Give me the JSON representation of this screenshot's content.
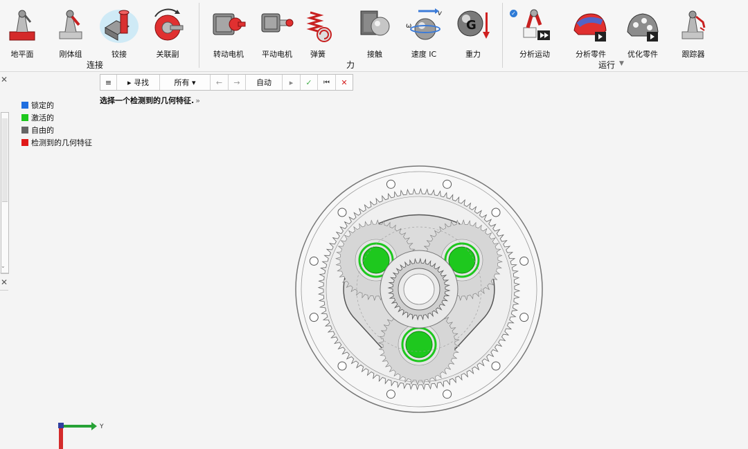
{
  "ribbon": {
    "tools": [
      {
        "label": "地平面",
        "icon": "ground-plane-icon"
      },
      {
        "label": "刚体组",
        "icon": "rigid-group-icon"
      },
      {
        "label": "铰接",
        "icon": "joint-icon"
      },
      {
        "label": "关联副",
        "icon": "coupler-icon"
      },
      {
        "label": "转动电机",
        "icon": "rotary-motor-icon"
      },
      {
        "label": "平动电机",
        "icon": "linear-motor-icon"
      },
      {
        "label": "弹簧",
        "icon": "spring-icon"
      },
      {
        "label": "接触",
        "icon": "contact-icon"
      },
      {
        "label": "速度 IC",
        "icon": "velocity-ic-icon"
      },
      {
        "label": "重力",
        "icon": "gravity-icon"
      },
      {
        "label": "分析运动",
        "icon": "analyze-motion-icon"
      },
      {
        "label": "分析零件",
        "icon": "analyze-part-icon"
      },
      {
        "label": "优化零件",
        "icon": "optimize-part-icon"
      },
      {
        "label": "跟踪器",
        "icon": "tracker-icon"
      }
    ],
    "groups": {
      "connect": "连接",
      "force": "力",
      "run": "运行"
    }
  },
  "guidebar": {
    "menu": "≡",
    "find": "▸ 寻找",
    "filter": "所有 ▾",
    "prev": "←",
    "next": "→",
    "mode": "自动",
    "play": "▸",
    "ok": "✓",
    "skip": "⏮",
    "cancel": "✕"
  },
  "prompt": {
    "text": "选择一个检测到的几何特征.",
    "more": "»"
  },
  "legend": {
    "items": [
      {
        "label": "锁定的",
        "color": "#1f6fe0"
      },
      {
        "label": "激活的",
        "color": "#1ec81e"
      },
      {
        "label": "自由的",
        "color": "#666666"
      },
      {
        "label": "检测到的几何特征",
        "color": "#e01818"
      }
    ]
  },
  "triad": {
    "axis_label": "Y"
  },
  "colors": {
    "accent": "#2e7bd6",
    "active": "#1ec81e"
  }
}
